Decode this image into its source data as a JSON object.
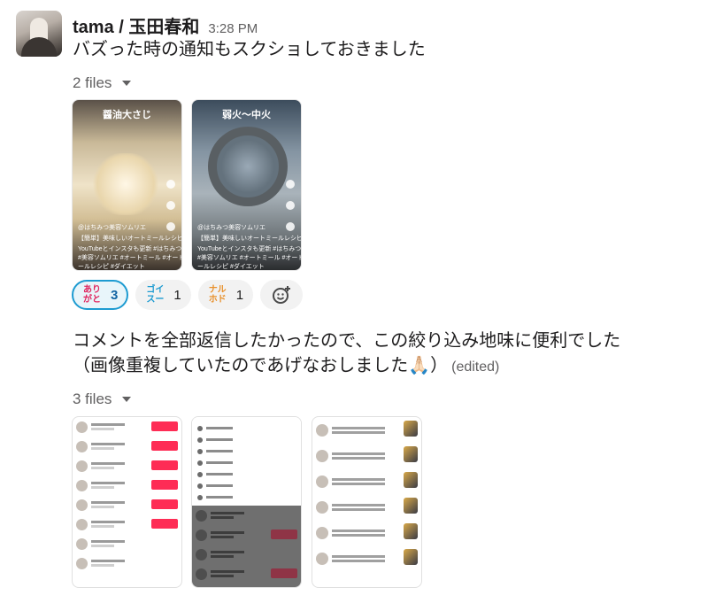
{
  "message": {
    "user_name": "tama / 玉田春和",
    "timestamp": "3:28 PM",
    "text": "バズった時の通知もスクショしておきました",
    "files_label": "2 files",
    "files": [
      {
        "overlay_top": "醤油大さじ",
        "caption_user": "@はちみつ美容ソムリエ",
        "caption_line1": "【簡単】美味しいオートミールレシピ",
        "caption_line2": "#美容ソムリエ #オートミール #オートミ",
        "caption_line3": "ールレシピ #ダイエット",
        "caption_line4": "YouTubeとインスタも更新 #はちみつ"
      },
      {
        "overlay_top": "弱火〜中火",
        "caption_user": "@はちみつ美容ソムリエ",
        "caption_line1": "【簡単】美味しいオートミールレシピ",
        "caption_line2": "#美容ソムリエ #オートミール #オートミ",
        "caption_line3": "ールレシピ #ダイエット",
        "caption_line4": "YouTubeとインスタも更新 #はちみつ"
      }
    ],
    "reactions": [
      {
        "emoji_line1": "あり",
        "emoji_line2": "がと",
        "count": "3",
        "active": true,
        "color": "#e0245e"
      },
      {
        "emoji_line1": "ゴイ",
        "emoji_line2": "スー",
        "count": "1",
        "active": false,
        "color": "#1d9bd1"
      },
      {
        "emoji_line1": "ナル",
        "emoji_line2": "ホド",
        "count": "1",
        "active": false,
        "color": "#e8912d"
      }
    ],
    "add_reaction_icon": "add-emoji-icon"
  },
  "message2": {
    "text_line1": "コメントを全部返信したかったので、この絞り込み地味に便利でした",
    "text_line2": "（画像重複していたのであげなおしました🙏🏻）",
    "edited_label": "(edited)",
    "files_label": "3 files"
  },
  "colors": {
    "text": "#1d1c1d",
    "muted": "#616061",
    "reaction_active_border": "#1d9bd1",
    "reaction_active_bg": "#e8f5fa",
    "follow_button": "#fe2c55"
  }
}
